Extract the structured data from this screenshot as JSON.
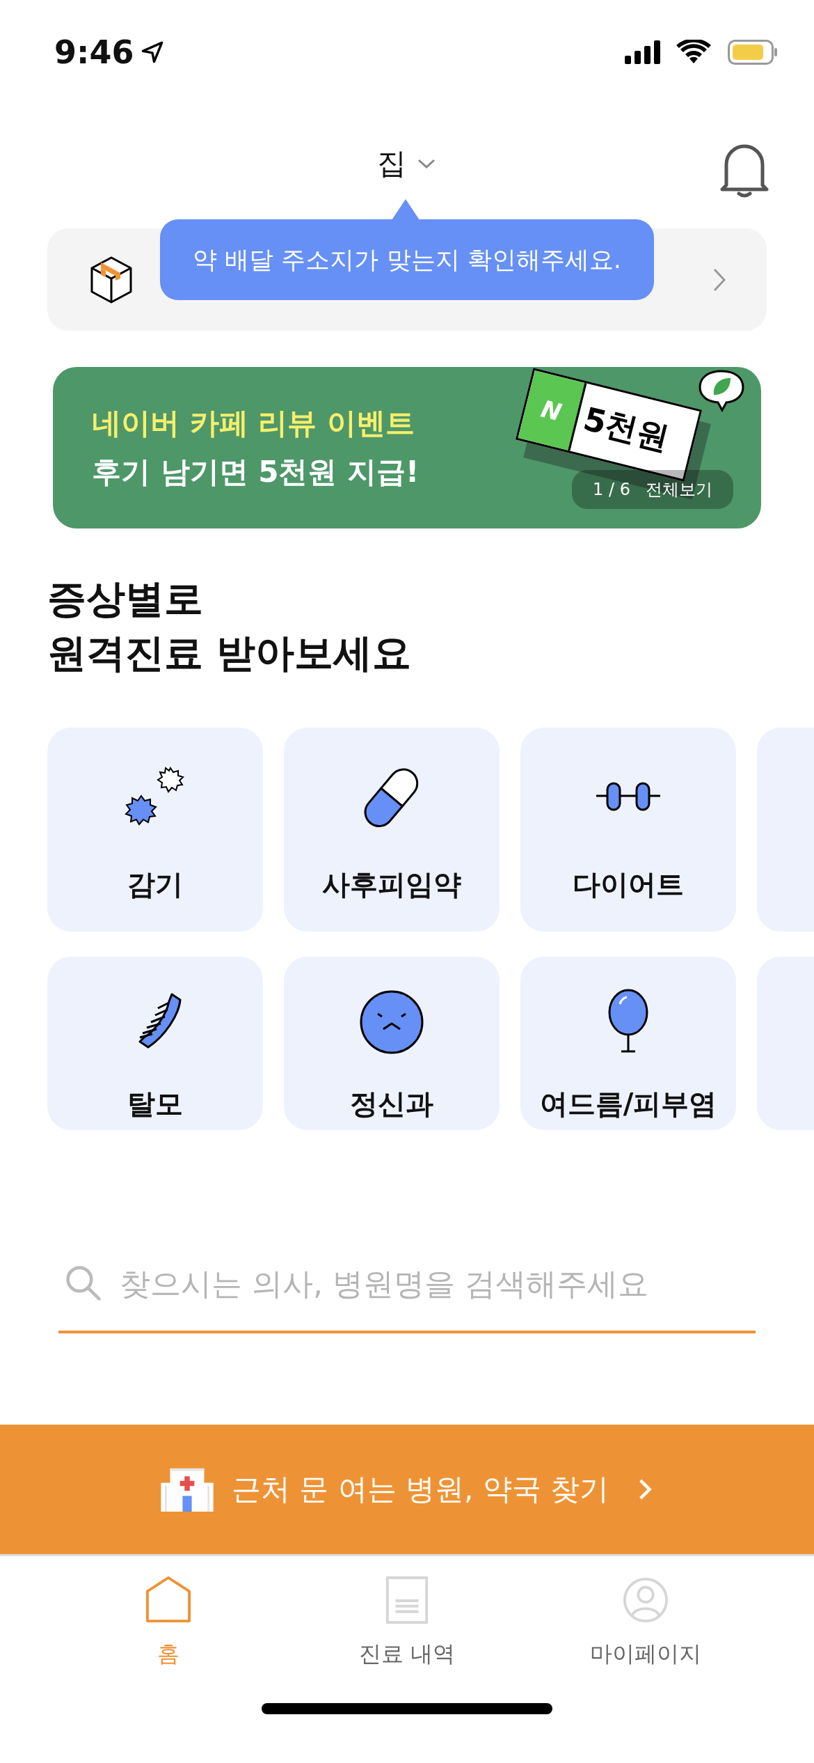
{
  "status_bar": {
    "time": "9:46"
  },
  "header": {
    "location": "집"
  },
  "tooltip": {
    "text": "약 배달 주소지가 맞는지 확인해주세요."
  },
  "banner": {
    "title": "네이버 카페 리뷰 이벤트",
    "subtitle": "후기 남기면 5천원 지급!",
    "ticket_letter": "N",
    "ticket_amount": "5천원",
    "page": "1 / 6",
    "view_all": "전체보기"
  },
  "section_title": [
    "증상별로",
    "원격진료 받아보세요"
  ],
  "category_rows": [
    {
      "items": [
        {
          "kind": "germs",
          "label": "감기"
        },
        {
          "kind": "pill",
          "label": "사후피임약"
        },
        {
          "kind": "dumbbell",
          "label": "다이어트"
        },
        {
          "kind": "cut_off"
        }
      ]
    },
    {
      "items": [
        {
          "kind": "comb",
          "label": "탈모"
        },
        {
          "kind": "face",
          "label": "정신과"
        },
        {
          "kind": "mirror",
          "label": "여드름/피부염"
        },
        {
          "kind": "cut_off"
        }
      ]
    }
  ],
  "search": {
    "placeholder": "찾으시는 의사, 병원명을 검색해주세요"
  },
  "cta": {
    "label": "근처 문 여는 병원, 약국 찾기"
  },
  "tabs": [
    {
      "kind": "home",
      "label": "홈",
      "selected": true
    },
    {
      "kind": "record",
      "label": "진료 내역",
      "selected": false
    },
    {
      "kind": "profile",
      "label": "마이페이지",
      "selected": false
    }
  ]
}
